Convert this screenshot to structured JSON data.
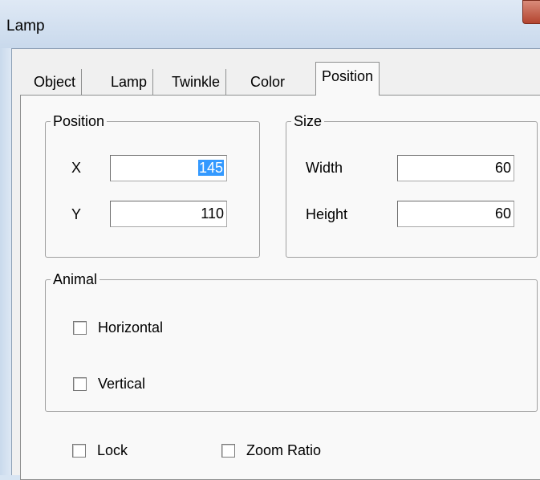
{
  "window": {
    "title": "Lamp"
  },
  "tabs": [
    {
      "label": "Object"
    },
    {
      "label": "Lamp"
    },
    {
      "label": "Twinkle"
    },
    {
      "label": "Color"
    },
    {
      "label": "Position",
      "selected": true
    }
  ],
  "position_group": {
    "title": "Position",
    "x_label": "X",
    "x_value": "145",
    "y_label": "Y",
    "y_value": "110"
  },
  "size_group": {
    "title": "Size",
    "width_label": "Width",
    "width_value": "60",
    "height_label": "Height",
    "height_value": "60"
  },
  "animal_group": {
    "title": "Animal",
    "horizontal_label": "Horizontal",
    "horizontal_checked": false,
    "vertical_label": "Vertical",
    "vertical_checked": false
  },
  "options": {
    "lock_label": "Lock",
    "lock_checked": false,
    "zoom_ratio_label": "Zoom Ratio",
    "zoom_ratio_checked": false
  },
  "colors": {
    "selection": "#3399ff",
    "close_button": "#c0563f"
  }
}
